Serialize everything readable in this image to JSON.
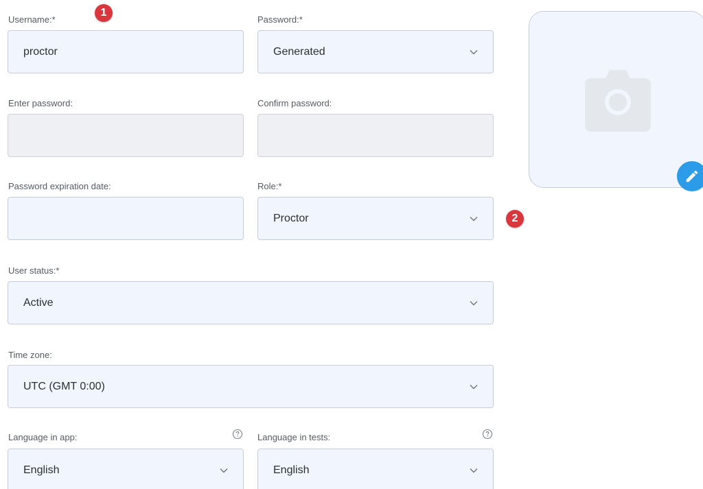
{
  "form": {
    "username": {
      "label": "Username:*",
      "value": "proctor"
    },
    "password": {
      "label": "Password:*",
      "value": "Generated"
    },
    "enter_password": {
      "label": "Enter password:",
      "value": ""
    },
    "confirm_password": {
      "label": "Confirm password:",
      "value": ""
    },
    "expiration_date": {
      "label": "Password expiration date:",
      "value": ""
    },
    "role": {
      "label": "Role:*",
      "value": "Proctor"
    },
    "user_status": {
      "label": "User status:*",
      "value": "Active"
    },
    "time_zone": {
      "label": "Time zone:",
      "value": "UTC (GMT 0:00)"
    },
    "language_app": {
      "label": "Language in app:",
      "value": "English",
      "help_icon": "question-circle-icon"
    },
    "language_tests": {
      "label": "Language in tests:",
      "value": "English",
      "help_icon": "question-circle-icon"
    }
  },
  "annotations": [
    {
      "number": "1"
    },
    {
      "number": "2"
    }
  ],
  "avatar": {
    "placeholder_icon": "camera-icon",
    "edit_icon": "pencil-icon"
  },
  "colors": {
    "field_background": "#f1f5fd",
    "field_border": "#c7cdd8",
    "disabled_background": "#eef0f3",
    "annotation_badge": "#d9363e",
    "edit_button": "#2c9be8"
  }
}
